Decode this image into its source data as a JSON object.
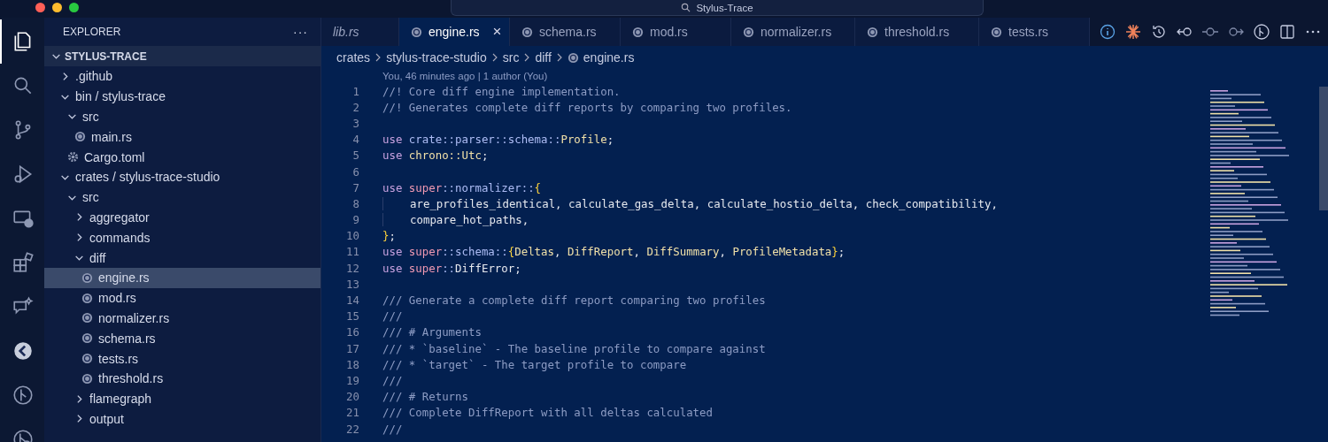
{
  "window": {
    "title": "Stylus-Trace"
  },
  "activity_bar": [
    {
      "kind": "files",
      "selected": true
    },
    {
      "kind": "search",
      "selected": false
    },
    {
      "kind": "branch",
      "selected": false
    },
    {
      "kind": "debug",
      "selected": false
    },
    {
      "kind": "remote",
      "selected": false
    },
    {
      "kind": "extensions",
      "selected": false
    },
    {
      "kind": "chat",
      "selected": false
    },
    {
      "kind": "logo",
      "selected": false
    },
    {
      "kind": "graph",
      "selected": false
    },
    {
      "kind": "pull",
      "selected": false
    }
  ],
  "sidebar": {
    "title": "EXPLORER",
    "more": "···",
    "root": "STYLUS-TRACE",
    "tree": [
      {
        "label": ".github",
        "kind": "folder",
        "expanded": false,
        "selected": false
      },
      {
        "label": "bin / stylus-trace",
        "kind": "folder",
        "expanded": true,
        "selected": false,
        "children": [
          {
            "label": "src",
            "kind": "folder",
            "expanded": true,
            "selected": false,
            "children": [
              {
                "label": "main.rs",
                "kind": "rust",
                "selected": false
              }
            ]
          },
          {
            "label": "Cargo.toml",
            "kind": "config",
            "selected": false
          }
        ]
      },
      {
        "label": "crates / stylus-trace-studio",
        "kind": "folder",
        "expanded": true,
        "selected": false,
        "children": [
          {
            "label": "src",
            "kind": "folder",
            "expanded": true,
            "selected": false,
            "children": [
              {
                "label": "aggregator",
                "kind": "folder",
                "expanded": false,
                "selected": false
              },
              {
                "label": "commands",
                "kind": "folder",
                "expanded": false,
                "selected": false
              },
              {
                "label": "diff",
                "kind": "folder",
                "expanded": true,
                "selected": false,
                "children": [
                  {
                    "label": "engine.rs",
                    "kind": "rust",
                    "selected": true
                  },
                  {
                    "label": "mod.rs",
                    "kind": "rust",
                    "selected": false
                  },
                  {
                    "label": "normalizer.rs",
                    "kind": "rust",
                    "selected": false
                  },
                  {
                    "label": "schema.rs",
                    "kind": "rust",
                    "selected": false
                  },
                  {
                    "label": "tests.rs",
                    "kind": "rust",
                    "selected": false
                  },
                  {
                    "label": "threshold.rs",
                    "kind": "rust",
                    "selected": false
                  }
                ]
              },
              {
                "label": "flamegraph",
                "kind": "folder",
                "expanded": false,
                "selected": false
              },
              {
                "label": "output",
                "kind": "folder",
                "expanded": false,
                "selected": false
              }
            ]
          }
        ]
      }
    ]
  },
  "tabs": [
    {
      "label": "lib.rs",
      "preview": true,
      "selected": false
    },
    {
      "label": "engine.rs",
      "preview": false,
      "selected": true,
      "close": "×"
    },
    {
      "label": "schema.rs",
      "preview": false,
      "selected": false
    },
    {
      "label": "mod.rs",
      "preview": false,
      "selected": false
    },
    {
      "label": "normalizer.rs",
      "preview": false,
      "selected": false
    },
    {
      "label": "threshold.rs",
      "preview": false,
      "selected": false
    },
    {
      "label": "tests.rs",
      "preview": false,
      "selected": false
    }
  ],
  "breadcrumb": [
    "crates",
    "stylus-trace-studio",
    "src",
    "diff",
    "engine.rs"
  ],
  "codelens": "You, 46 minutes ago | 1 author (You)",
  "code": [
    {
      "number": "1",
      "tokens": [
        {
          "kind": "comment",
          "text": "//! Core diff engine implementation."
        }
      ]
    },
    {
      "number": "2",
      "tokens": [
        {
          "kind": "comment",
          "text": "//! Generates complete diff reports by comparing two profiles."
        }
      ]
    },
    {
      "number": "3"
    },
    {
      "number": "4",
      "tokens": [
        {
          "kind": "keyword",
          "text": "use "
        },
        {
          "kind": "path",
          "text": "crate::parser::schema::"
        },
        {
          "kind": "type",
          "text": "Profile"
        },
        {
          "kind": "plain",
          "text": ";"
        }
      ]
    },
    {
      "number": "5",
      "tokens": [
        {
          "kind": "keyword",
          "text": "use "
        },
        {
          "kind": "type",
          "text": "chrono::Utc"
        },
        {
          "kind": "plain",
          "text": ";"
        }
      ]
    },
    {
      "number": "6"
    },
    {
      "number": "7",
      "tokens": [
        {
          "kind": "keyword",
          "text": "use "
        },
        {
          "kind": "super",
          "text": "super"
        },
        {
          "kind": "path",
          "text": "::normalizer::"
        },
        {
          "kind": "brace",
          "text": "{"
        }
      ]
    },
    {
      "number": "8",
      "indent": true,
      "tokens": [
        {
          "kind": "plain",
          "text": "are_profiles_identical, calculate_gas_delta, calculate_hostio_delta, check_compatibility,"
        }
      ]
    },
    {
      "number": "9",
      "indent": true,
      "tokens": [
        {
          "kind": "plain",
          "text": "compare_hot_paths,"
        }
      ]
    },
    {
      "number": "10",
      "tokens": [
        {
          "kind": "brace",
          "text": "}"
        },
        {
          "kind": "plain",
          "text": ";"
        }
      ]
    },
    {
      "number": "11",
      "tokens": [
        {
          "kind": "keyword",
          "text": "use "
        },
        {
          "kind": "super",
          "text": "super"
        },
        {
          "kind": "path",
          "text": "::schema::"
        },
        {
          "kind": "brace",
          "text": "{"
        },
        {
          "kind": "type",
          "text": "Deltas"
        },
        {
          "kind": "plain",
          "text": ", "
        },
        {
          "kind": "type",
          "text": "DiffReport"
        },
        {
          "kind": "plain",
          "text": ", "
        },
        {
          "kind": "type",
          "text": "DiffSummary"
        },
        {
          "kind": "plain",
          "text": ", "
        },
        {
          "kind": "type",
          "text": "ProfileMetadata"
        },
        {
          "kind": "brace",
          "text": "}"
        },
        {
          "kind": "plain",
          "text": ";"
        }
      ]
    },
    {
      "number": "12",
      "tokens": [
        {
          "kind": "keyword",
          "text": "use "
        },
        {
          "kind": "super",
          "text": "super"
        },
        {
          "kind": "path",
          "text": "::"
        },
        {
          "kind": "plain",
          "text": "DiffError;"
        }
      ]
    },
    {
      "number": "13"
    },
    {
      "number": "14",
      "tokens": [
        {
          "kind": "comment",
          "text": "/// Generate a complete diff report comparing two profiles"
        }
      ]
    },
    {
      "number": "15",
      "tokens": [
        {
          "kind": "comment",
          "text": "///"
        }
      ]
    },
    {
      "number": "16",
      "tokens": [
        {
          "kind": "comment",
          "text": "/// # Arguments"
        }
      ]
    },
    {
      "number": "17",
      "tokens": [
        {
          "kind": "comment",
          "text": "/// * `baseline` - The baseline profile to compare against"
        }
      ]
    },
    {
      "number": "18",
      "tokens": [
        {
          "kind": "comment",
          "text": "/// * `target` - The target profile to compare"
        }
      ]
    },
    {
      "number": "19",
      "tokens": [
        {
          "kind": "comment",
          "text": "///"
        }
      ]
    },
    {
      "number": "20",
      "tokens": [
        {
          "kind": "comment",
          "text": "/// # Returns"
        }
      ]
    },
    {
      "number": "21",
      "tokens": [
        {
          "kind": "comment",
          "text": "/// Complete DiffReport with all deltas calculated"
        }
      ]
    },
    {
      "number": "22",
      "tokens": [
        {
          "kind": "comment",
          "text": "///"
        }
      ]
    }
  ]
}
